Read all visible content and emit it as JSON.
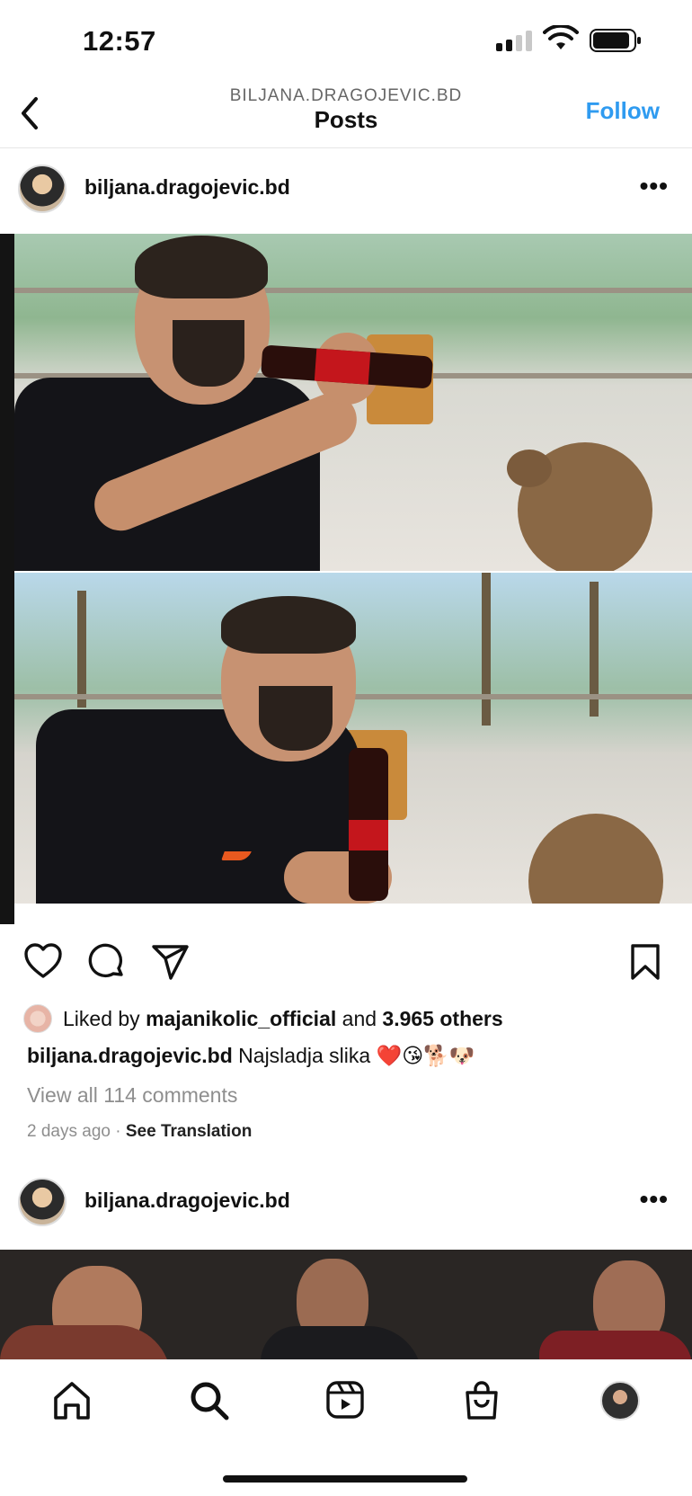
{
  "status_bar": {
    "time": "12:57"
  },
  "nav": {
    "subtitle": "BILJANA.DRAGOJEVIC.BD",
    "title": "Posts",
    "follow_label": "Follow",
    "back_icon": "chevron-left-icon"
  },
  "post1": {
    "username": "biljana.dragojevic.bd",
    "more_label": "•••",
    "likes": {
      "prefix": "Liked by",
      "user": "majanikolic_official",
      "middle": "and",
      "count": "3.965 others"
    },
    "caption": {
      "username": "biljana.dragojevic.bd",
      "text": "Najsladja slika",
      "emojis": "❤️😘🐕🐶"
    },
    "view_comments": "View all 114 comments",
    "time_ago": "2 days ago",
    "separator": "·",
    "see_translation": "See Translation"
  },
  "post2": {
    "username": "biljana.dragojevic.bd",
    "more_label": "•••"
  },
  "colors": {
    "accent": "#2f9bf0",
    "like_red": "#e0245e",
    "text": "#111111",
    "muted": "#8e8e8e"
  },
  "icons": [
    "heart-icon",
    "comment-icon",
    "share-icon",
    "bookmark-icon",
    "home-icon",
    "search-icon",
    "reels-icon",
    "shop-icon"
  ]
}
